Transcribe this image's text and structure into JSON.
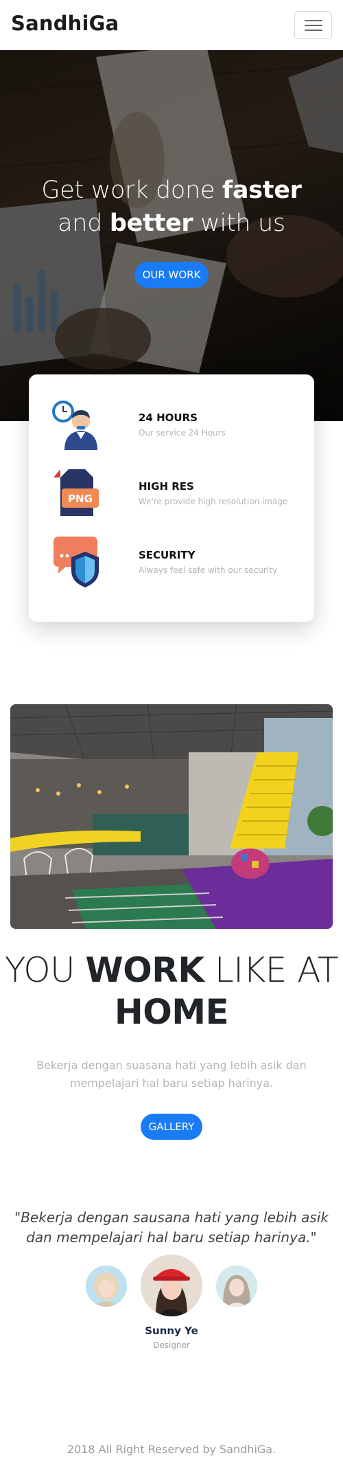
{
  "navbar": {
    "brand": "SandhiGa",
    "toggle_icon": "hamburger-icon"
  },
  "hero": {
    "title_part1": "Get work done ",
    "title_bold1": "faster",
    "title_part2": "and ",
    "title_bold2": "better",
    "title_part3": " with us",
    "button_label": "OUR WORK"
  },
  "features": [
    {
      "title": "24 HOURS",
      "description": "Our service 24 Hours",
      "icon": "clock-agent-icon"
    },
    {
      "title": "HIGH RES",
      "description": "We're provide high resolution image",
      "icon": "png-file-icon",
      "icon_text": "PNG"
    },
    {
      "title": "SECURITY",
      "description": "Always feel safe with our security",
      "icon": "chat-shield-icon"
    }
  ],
  "work": {
    "title_part1": "YOU ",
    "title_bold": "WORK",
    "title_part2": " LIKE AT",
    "title_line2": "HOME",
    "description": "Bekerja dengan suasana hati yang lebih asik dan mempelajari hal baru setiap harinya.",
    "button_label": "GALLERY"
  },
  "testimonial": {
    "quote": "\"Bekerja dengan sausana hati yang lebih asik dan mempelajari hal baru setiap harinya.\"",
    "name": "Sunny Ye",
    "role": "Designer"
  },
  "footer": {
    "text": "2018 All Right Reserved by SandhiGa."
  },
  "colors": {
    "accent": "#1a7cf5",
    "text_dark": "#212529",
    "muted": "#b5b5b5"
  }
}
